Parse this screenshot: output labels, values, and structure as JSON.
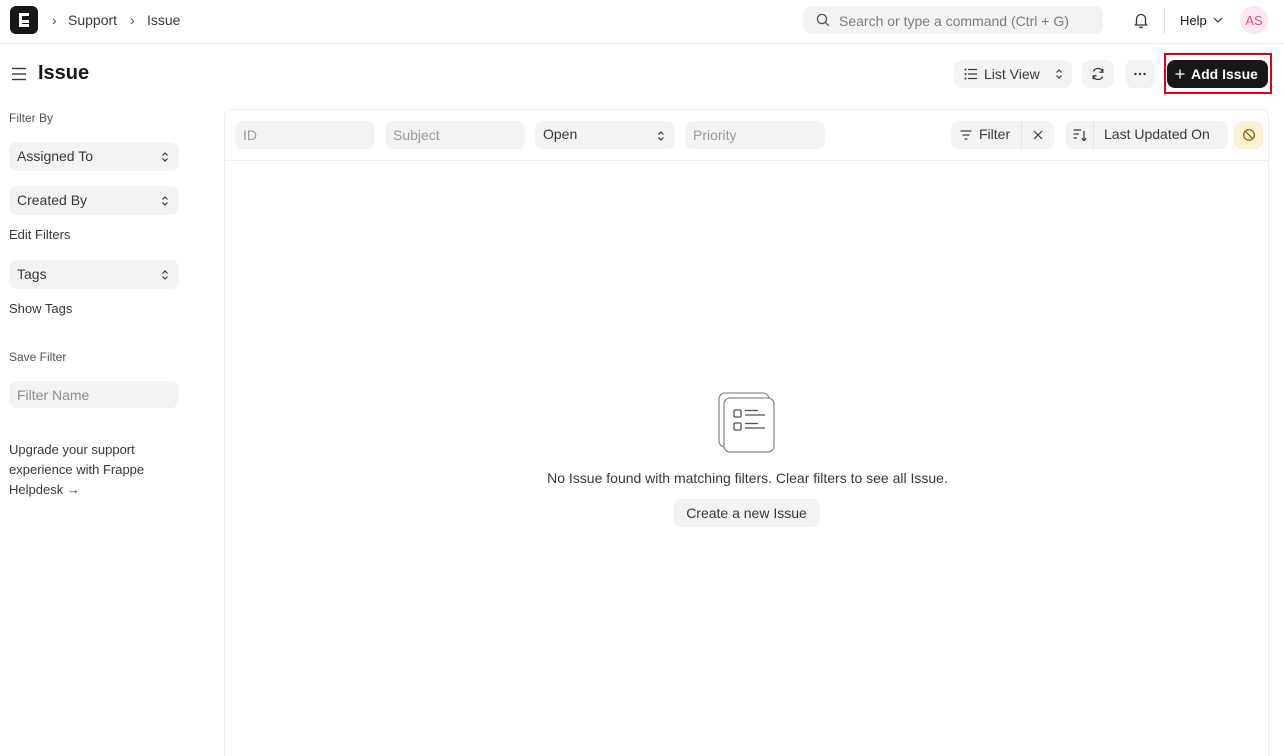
{
  "breadcrumbs": [
    "Support",
    "Issue"
  ],
  "search": {
    "placeholder": "Search or type a command (Ctrl + G)"
  },
  "navbar": {
    "help_label": "Help",
    "avatar_initials": "AS"
  },
  "page": {
    "title": "Issue"
  },
  "toolbar": {
    "view_label": "List View",
    "add_label": "Add Issue"
  },
  "sidebar": {
    "filter_by_label": "Filter By",
    "assigned_to_label": "Assigned To",
    "created_by_label": "Created By",
    "edit_filters_label": "Edit Filters",
    "tags_label": "Tags",
    "show_tags_label": "Show Tags",
    "save_filter_label": "Save Filter",
    "filter_name_placeholder": "Filter Name",
    "upgrade_text": "Upgrade your support experience with Frappe Helpdesk →"
  },
  "filters": {
    "id_placeholder": "ID",
    "subject_placeholder": "Subject",
    "status_value": "Open",
    "priority_placeholder": "Priority",
    "filter_label": "Filter",
    "sort_label": "Last Updated On"
  },
  "empty_state": {
    "message": "No Issue found with matching filters. Clear filters to see all Issue.",
    "create_label": "Create a new Issue"
  },
  "colors": {
    "primary_button": "#171717",
    "highlight_border": "#e0000f",
    "avatar_text": "#e0508f"
  }
}
